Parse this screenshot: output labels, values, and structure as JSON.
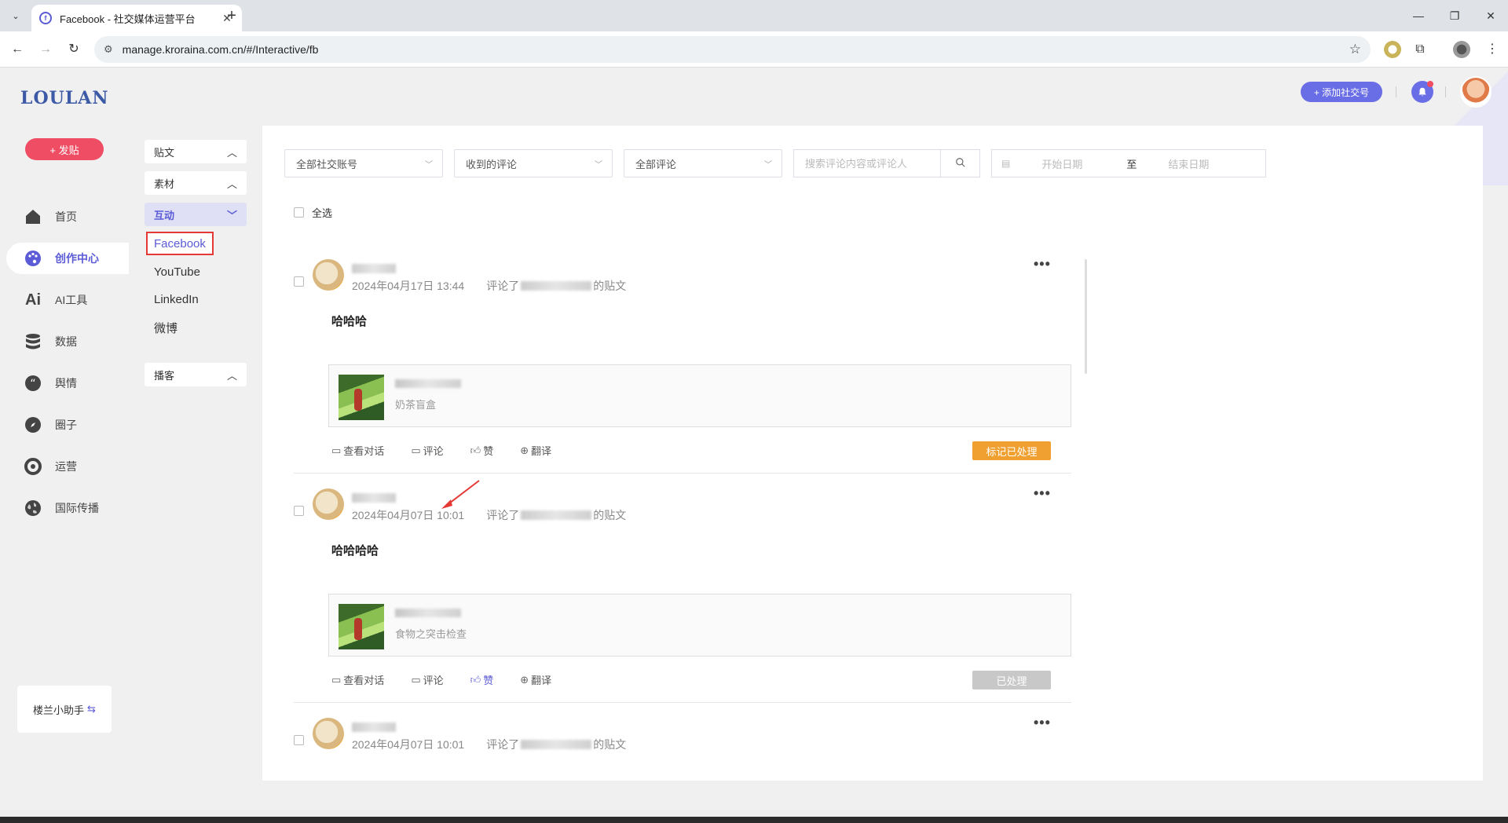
{
  "browser": {
    "tab_title": "Facebook - 社交媒体运营平台",
    "tab_close": "✕",
    "new_tab": "+",
    "url": "manage.kroraina.com.cn/#/Interactive/fb",
    "minimize": "—",
    "restore": "❐",
    "close": "✕"
  },
  "app": {
    "logo": "LOULAN",
    "post_button": "+ 发贴",
    "nav": [
      {
        "label": "首页",
        "icon": "home-icon"
      },
      {
        "label": "创作中心",
        "icon": "palette-icon"
      },
      {
        "label": "AI工具",
        "icon": "ai-icon"
      },
      {
        "label": "数据",
        "icon": "database-icon"
      },
      {
        "label": "舆情",
        "icon": "quote-icon"
      },
      {
        "label": "圈子",
        "icon": "compass-icon"
      },
      {
        "label": "运营",
        "icon": "operation-icon"
      },
      {
        "label": "国际传播",
        "icon": "globe-icon"
      }
    ],
    "helper": "楼兰小助手",
    "helper_icon": "⇆",
    "add_social": "+ 添加社交号",
    "accent_color": "#5b5bd6"
  },
  "subnav": {
    "groups": [
      "贴文",
      "素材",
      "互动",
      "播客"
    ],
    "links": [
      "Facebook",
      "YouTube",
      "LinkedIn",
      "微博"
    ]
  },
  "filters": {
    "account": "全部社交账号",
    "type": "收到的评论",
    "scope": "全部评论",
    "search_placeholder": "搜索评论内容或评论人",
    "start_date": "开始日期",
    "date_sep": "至",
    "end_date": "结束日期"
  },
  "select_all": "全选",
  "comments": [
    {
      "time": "2024年04月17日 13:44",
      "commented": "评论了",
      "post_suffix": "的贴文",
      "content": "哈哈哈",
      "post_sub": "奶茶盲盒",
      "status": "标记已处理"
    },
    {
      "time": "2024年04月07日 10:01",
      "commented": "评论了",
      "post_suffix": "的贴文",
      "content": "哈哈哈哈",
      "post_sub": "食物之突击检查",
      "status": "已处理"
    },
    {
      "time": "2024年04月07日 10:01",
      "commented": "评论了",
      "post_suffix": "的贴文"
    }
  ],
  "actions": {
    "view_thread": "查看对话",
    "comment": "评论",
    "like": "赞",
    "translate": "翻译"
  },
  "more": "•••"
}
